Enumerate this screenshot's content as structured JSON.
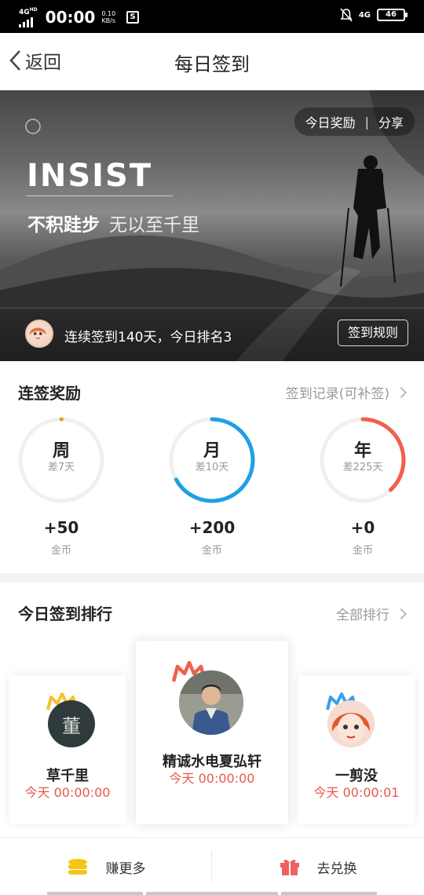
{
  "status_bar": {
    "network_left": "4G",
    "network_sup": "HD",
    "time": "00:00",
    "speed_value": "0.10",
    "speed_unit": "KB/s",
    "s_icon": "S",
    "network_right": "4G",
    "battery": "46"
  },
  "nav": {
    "back_label": "返回",
    "title": "每日签到"
  },
  "banner": {
    "reward_label": "今日奖励",
    "separator": "|",
    "share_label": "分享",
    "headline": "INSIST",
    "slogan_main": "不积跬步",
    "slogan_sub": "无以至千里",
    "stat": "连续签到140天，今日排名3",
    "rules_button": "签到规则"
  },
  "rewards": {
    "title": "连签奖励",
    "link": "签到记录(可补签)",
    "items": [
      {
        "label": "周",
        "sub": "差7天",
        "value": "+50",
        "unit": "金币",
        "progress": 0.0,
        "color": "#f0a020"
      },
      {
        "label": "月",
        "sub": "差10天",
        "value": "+200",
        "unit": "金币",
        "progress": 0.67,
        "color": "#1ea0e6"
      },
      {
        "label": "年",
        "sub": "差225天",
        "value": "+0",
        "unit": "金币",
        "progress": 0.38,
        "color": "#f0604c"
      }
    ]
  },
  "ranking": {
    "title": "今日签到排行",
    "link": "全部排行",
    "entries": [
      {
        "name": "精诚水电夏弘轩",
        "time": "今天 00:00:00",
        "crown_color": "#f0604c"
      },
      {
        "name": "草千里",
        "time": "今天 00:00:00",
        "crown_color": "#f2c230",
        "avatar_char": "董"
      },
      {
        "name": "一剪没",
        "time": "今天 00:00:01",
        "crown_color": "#3aa0e8"
      }
    ]
  },
  "bottom": {
    "earn_label": "赚更多",
    "exchange_label": "去兑换"
  },
  "icons": {
    "back": "chevron-left-icon",
    "coins": "coin-stack-icon",
    "gift": "gift-icon"
  }
}
